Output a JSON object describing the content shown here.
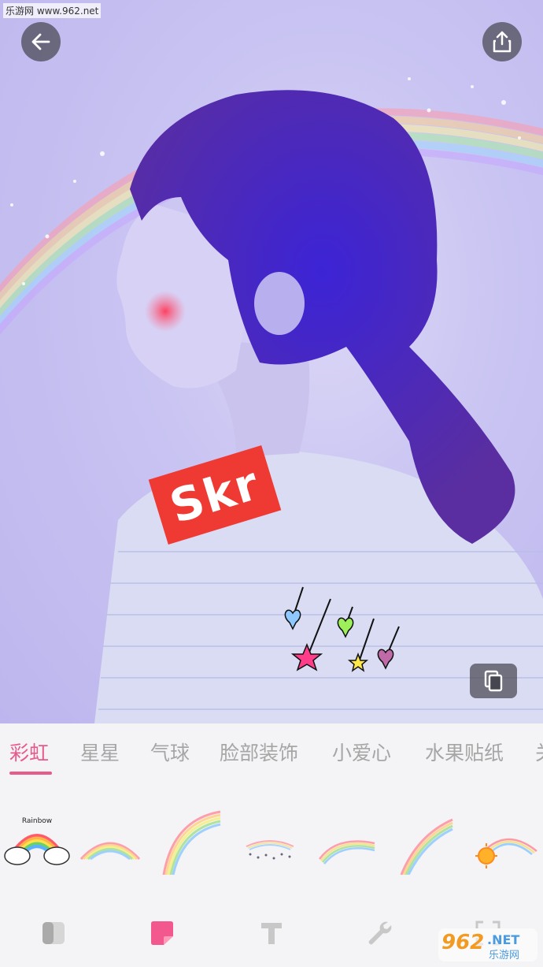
{
  "watermark_top": "乐游网 www.962.net",
  "photo_sticker": {
    "text": "Skr"
  },
  "icons": {
    "back": "arrow-left-icon",
    "share": "share-upload-icon",
    "copy": "duplicate-icon"
  },
  "categories": {
    "active_index": 0,
    "items": [
      "彩虹",
      "星星",
      "气球",
      "脸部装饰",
      "小爱心",
      "水果贴纸",
      "关"
    ]
  },
  "stickers": [
    {
      "name": "rainbow-cloud-sticker",
      "label": "Rainbow"
    },
    {
      "name": "rainbow-arc-sticker"
    },
    {
      "name": "rainbow-large-arc-sticker"
    },
    {
      "name": "rainbow-sparkle-sticker"
    },
    {
      "name": "rainbow-thin-arc-sticker"
    },
    {
      "name": "rainbow-diagonal-sticker"
    },
    {
      "name": "rainbow-sun-sticker"
    }
  ],
  "toolbar": [
    "filter-icon",
    "sticker-icon",
    "text-icon",
    "wrench-icon",
    "crop-icon"
  ],
  "watermark_logo": {
    "brand": "962",
    "suffix": ".NET",
    "subtitle": "乐游网"
  },
  "colors": {
    "accent": "#e85a89",
    "sticker_red": "#ef3a33",
    "photo_tint": "#c9c4f2"
  }
}
